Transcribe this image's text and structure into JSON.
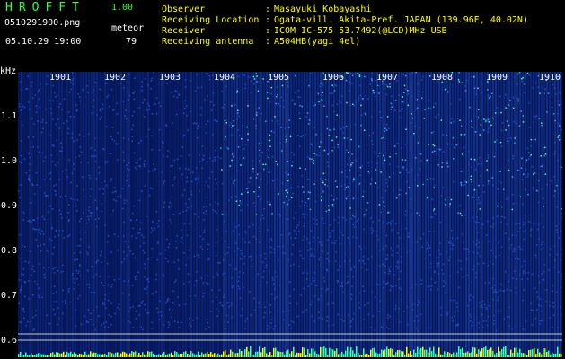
{
  "header": {
    "app_title": "HROFFT",
    "app_version": "1.00",
    "file_name": "0510291900.png",
    "meteor_label": "meteor",
    "date_time": "05.10.29 19:00",
    "meteor_count": "79"
  },
  "info": [
    {
      "label": "Observer",
      "value": "Masayuki Kobayashi"
    },
    {
      "label": "Receiving Location",
      "value": "Ogata-vill. Akita-Pref. JAPAN (139.96E, 40.02N)"
    },
    {
      "label": "Receiver",
      "value": "ICOM IC-575 53.7492(@LCD)MHz USB"
    },
    {
      "label": "Receiving antenna",
      "value": "A504HB(yagi 4el)"
    }
  ],
  "axes": {
    "y_unit": "kHz",
    "y_ticks": [
      "1.1",
      "1.0",
      "0.9",
      "0.8",
      "0.7",
      "0.6"
    ],
    "x_ticks": [
      "1901",
      "1902",
      "1903",
      "1904",
      "1905",
      "1906",
      "1907",
      "1908",
      "1909",
      "1910"
    ]
  },
  "colors": {
    "background": "#000000",
    "label_yellow": "#ffff00",
    "value_white": "#ffffff",
    "title_green": "#33ff33",
    "spectrogram_dark": "#061a4a",
    "spectrogram_mid": "#1e50c8",
    "spectrogram_hot": "#3cffb4"
  }
}
